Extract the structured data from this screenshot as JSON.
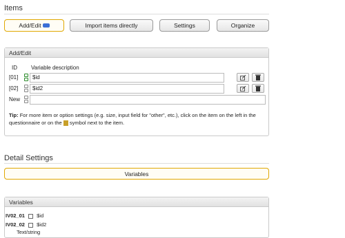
{
  "items_section": {
    "title": "Items"
  },
  "tabs": [
    {
      "label": "Add/Edit",
      "active": true
    },
    {
      "label": "Import items directly",
      "active": false
    },
    {
      "label": "Settings",
      "active": false
    },
    {
      "label": "Organize",
      "active": false
    }
  ],
  "add_edit_panel": {
    "title": "Add/Edit",
    "col_id": "ID",
    "col_desc": "Variable description",
    "rows": [
      {
        "id": "[01]",
        "value": "$id"
      },
      {
        "id": "[02]",
        "value": "$id2"
      }
    ],
    "new_label": "New",
    "new_value": "",
    "tip_label": "Tip:",
    "tip_text_1": "For more item or option settings (e.g. size, input field for \"other\", etc.), click on the item on the left in the questionnaire or on the",
    "tip_text_2": "symbol next to the item."
  },
  "detail_section": {
    "title": "Detail Settings"
  },
  "variables_button": {
    "label": "Variables"
  },
  "variables_panel": {
    "title": "Variables",
    "items": [
      {
        "name": "IV02_01",
        "value": "$id"
      },
      {
        "name": "IV02_02",
        "value": "$id2"
      }
    ],
    "type_text": "Text/string"
  },
  "colors": {
    "accent": "#e0a700",
    "icon_blue": "#3c6fd6"
  },
  "icons": {
    "edit": "edit-icon",
    "delete": "trash-icon",
    "move": "move-updown-icon",
    "tag": "tag-icon"
  }
}
